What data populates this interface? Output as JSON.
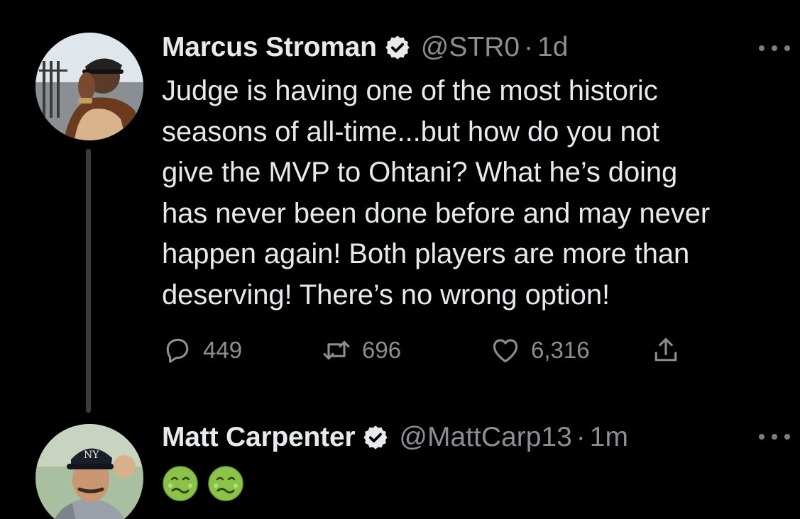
{
  "tweet1": {
    "name": "Marcus Stroman",
    "handle": "@STR0",
    "separator": "·",
    "time": "1d",
    "text": "Judge is having one of the most historic\nseasons of all-time...but how do you not\ngive the MVP to Ohtani? What he’s doing\nhas never been done before and may never\nhappen again! Both players are more than\ndeserving! There’s no wrong option!",
    "replies": "449",
    "retweets": "696",
    "likes": "6,316",
    "icons": {
      "verified": "verified-badge-icon",
      "more": "more-options-icon",
      "reply": "reply-icon",
      "retweet": "retweet-icon",
      "like": "heart-icon",
      "share": "share-icon"
    }
  },
  "tweet2": {
    "name": "Matt Carpenter",
    "handle": "@MattCarp13",
    "separator": "·",
    "time": "1m",
    "emojis": [
      "nauseated-face-emoji",
      "nauseated-face-emoji"
    ]
  },
  "colors": {
    "background": "#000000",
    "primary_text": "#e7e9ea",
    "secondary_text": "#8b8f94",
    "thread_line": "#3a3b3e",
    "emoji_green": "#8bc34a"
  }
}
